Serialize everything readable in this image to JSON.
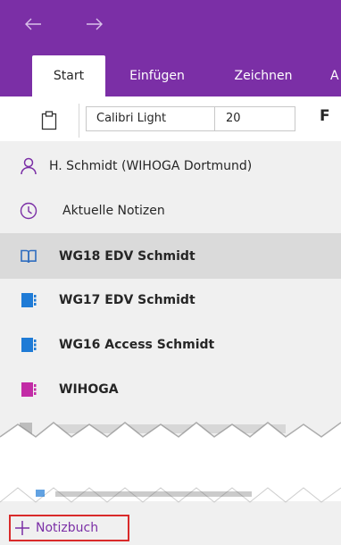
{
  "titlebar": {
    "back_icon": "arrow-left-icon",
    "forward_icon": "arrow-right-icon",
    "color": "#7b2fa6"
  },
  "tabs": [
    {
      "label": "Start",
      "active": true
    },
    {
      "label": "Einfügen",
      "active": false
    },
    {
      "label": "Zeichnen",
      "active": false
    },
    {
      "label": "A",
      "active": false
    }
  ],
  "ribbon": {
    "paste_icon": "clipboard-icon",
    "font_name": "Calibri Light",
    "font_size": "20",
    "bold_label": "F"
  },
  "account": {
    "label": "H. Schmidt (WIHOGA Dortmund)",
    "icon": "person-icon"
  },
  "recent": {
    "label": "Aktuelle Notizen",
    "icon": "clock-icon"
  },
  "notebooks": [
    {
      "label": "WG18 EDV Schmidt",
      "color": "#2f6dbf",
      "icon": "open-book-icon",
      "selected": true
    },
    {
      "label": "WG17 EDV Schmidt",
      "color": "#1f7bd6",
      "icon": "notebook-icon",
      "selected": false
    },
    {
      "label": "WG16 Access Schmidt",
      "color": "#1f7bd6",
      "icon": "notebook-icon",
      "selected": false
    },
    {
      "label": "WIHOGA",
      "color": "#c22ca6",
      "icon": "notebook-icon",
      "selected": false
    }
  ],
  "footer": {
    "add_label": "Notizbuch",
    "add_icon": "plus-icon",
    "highlight_color": "#d92a2a"
  }
}
